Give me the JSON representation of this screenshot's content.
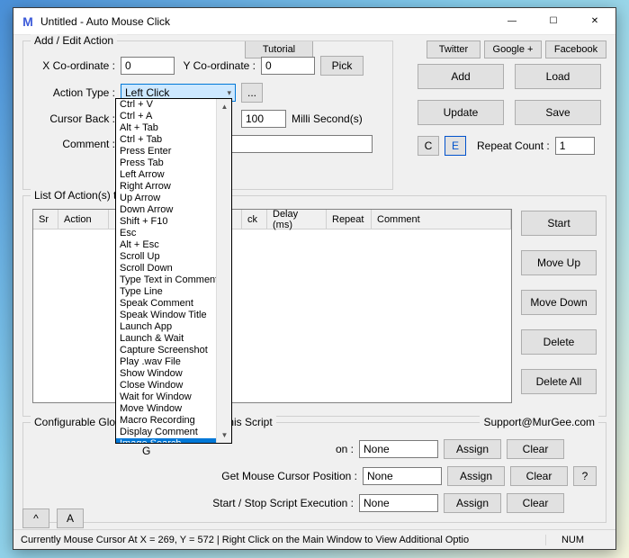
{
  "window": {
    "title": "Untitled - Auto Mouse Click"
  },
  "top_buttons": {
    "tutorial": "Tutorial",
    "twitter": "Twitter",
    "google": "Google +",
    "facebook": "Facebook"
  },
  "add_edit": {
    "legend": "Add / Edit Action",
    "x_label": "X Co-ordinate :",
    "x_value": "0",
    "y_label": "Y Co-ordinate :",
    "y_value": "0",
    "pick": "Pick",
    "action_type_label": "Action Type :",
    "action_type_selected": "Left Click",
    "action_extra": "...",
    "cursor_back_label": "Cursor Back :",
    "delay_value": "100",
    "delay_unit": "Milli Second(s)",
    "comment_label": "Comment :",
    "c_btn": "C",
    "e_btn": "E",
    "repeat_label": "Repeat Count :",
    "repeat_value": "1"
  },
  "dropdown_items": [
    "Ctrl + V",
    "Ctrl + A",
    "Alt + Tab",
    "Ctrl + Tab",
    "Press Enter",
    "Press Tab",
    "Left Arrow",
    "Right Arrow",
    "Up Arrow",
    "Down Arrow",
    "Shift + F10",
    "Esc",
    "Alt + Esc",
    "Scroll Up",
    "Scroll Down",
    "Type Text in Comment",
    "Type Line",
    "Speak Comment",
    "Speak Window Title",
    "Launch App",
    "Launch & Wait",
    "Capture Screenshot",
    "Play .wav File",
    "Show Window",
    "Close Window",
    "Wait for Window",
    "Move Window",
    "Macro Recording",
    "Display Comment",
    "Image Search"
  ],
  "list_section": {
    "legend": "List Of Action(s) to",
    "columns": {
      "sr": "Sr",
      "action": "Action",
      "ck": "ck",
      "delay": "Delay (ms)",
      "repeat": "Repeat",
      "comment": "Comment"
    }
  },
  "right_buttons": {
    "add": "Add",
    "load": "Load",
    "update": "Update",
    "save": "Save",
    "start": "Start",
    "move_up": "Move Up",
    "move_down": "Move Down",
    "delete": "Delete",
    "delete_all": "Delete All"
  },
  "global_section": {
    "legend": "Configurable Globa",
    "legend_suffix": "this Script",
    "support": "Support@MurGee.com",
    "g_label": "G",
    "row1_label": "on :",
    "row2_label": "Get Mouse Cursor Position :",
    "row3_label": "Start / Stop Script Execution :",
    "value": "None",
    "assign": "Assign",
    "clear": "Clear",
    "help": "?"
  },
  "nav": {
    "up": "^",
    "a": "A"
  },
  "status": {
    "text": "Currently Mouse Cursor At X = 269, Y = 572 | Right Click on the Main Window to View Additional Optio",
    "num": "NUM"
  }
}
